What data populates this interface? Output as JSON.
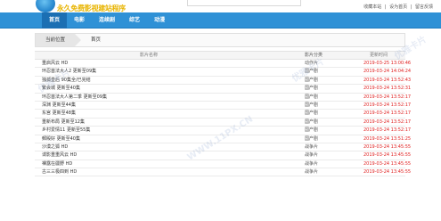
{
  "header": {
    "logo_text": "永久免费影视建站程序",
    "top_links": [
      "收藏本站",
      "设为首页",
      "留言反馈"
    ],
    "separator": "|"
  },
  "nav": {
    "items": [
      {
        "label": "首页"
      },
      {
        "label": "电影"
      },
      {
        "label": "连续剧"
      },
      {
        "label": "综艺"
      },
      {
        "label": "动漫"
      }
    ]
  },
  "breadcrumb": {
    "label": "当前位置",
    "current": "首页"
  },
  "table": {
    "headers": [
      "影片名称",
      "影片分类",
      "更新时间"
    ],
    "rows": [
      {
        "name": "重启风云 HD",
        "category": "动作片",
        "time": "2019-03-25 13:00:46"
      },
      {
        "name": "环忍首法大人2 更新至09集",
        "category": "国产剧",
        "time": "2019-03-24 14:04:24"
      },
      {
        "name": "独孤皇后 90集全/已完结",
        "category": "国产剧",
        "time": "2019-03-24 13:52:43"
      },
      {
        "name": "繁会城 更新至40集",
        "category": "国产剧",
        "time": "2019-03-24 13:52:31"
      },
      {
        "name": "环忍首法大人第二季 更新至09集",
        "category": "国产剧",
        "time": "2019-03-24 13:52:17"
      },
      {
        "name": "深渊 更新至44集",
        "category": "国产剧",
        "time": "2019-03-24 13:52:17"
      },
      {
        "name": "东宫 更新至48集",
        "category": "国产剧",
        "time": "2019-03-24 13:52:17"
      },
      {
        "name": "重新布局 更新至12集",
        "category": "国产剧",
        "time": "2019-03-24 13:52:17"
      },
      {
        "name": "乡村爱情11 更新至55集",
        "category": "国产剧",
        "time": "2019-03-24 13:52:17"
      },
      {
        "name": "郵殿好 更新至40集",
        "category": "国产剧",
        "time": "2019-03-24 13:51:25"
      },
      {
        "name": "沙漠之狐 HD",
        "category": "战争片",
        "time": "2019-03-24 13:45:55"
      },
      {
        "name": "谍影重重风云 HD",
        "category": "战争片",
        "time": "2019-03-24 13:45:55"
      },
      {
        "name": "裸露在疆野 HD",
        "category": "战争片",
        "time": "2019-03-24 13:45:55"
      },
      {
        "name": "古三三极四到 HD",
        "category": "战争片",
        "time": "2019-03-24 13:45:55"
      }
    ]
  },
  "watermarks": [
    "优雅卡片",
    "WWW.11PX.CN",
    "优雅卡片",
    "优雅卡片"
  ]
}
